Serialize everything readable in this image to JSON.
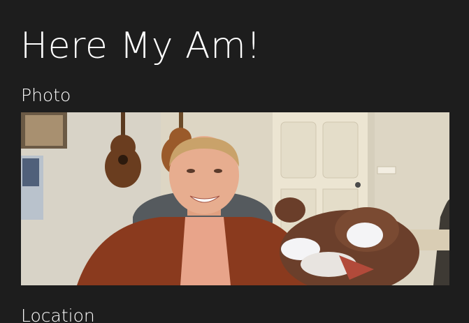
{
  "page": {
    "title": "Here My Am!"
  },
  "sections": {
    "photo_header": "Photo",
    "location_header": "Location"
  },
  "photo": {
    "icon": "camera-photo"
  },
  "colors": {
    "background": "#1d1d1d",
    "text": "#ffffff"
  }
}
